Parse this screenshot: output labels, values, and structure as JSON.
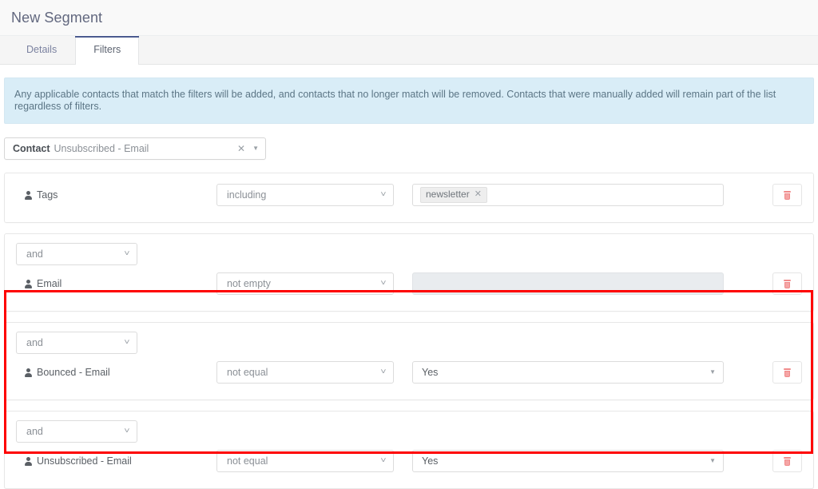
{
  "header": {
    "title": "New Segment"
  },
  "tabs": [
    {
      "label": "Details",
      "active": false
    },
    {
      "label": "Filters",
      "active": true
    }
  ],
  "alert": {
    "text": "Any applicable contacts that match the filters will be added, and contacts that no longer match will be removed. Contacts that were manually added will remain part of the list regardless of filters."
  },
  "contact_select": {
    "label": "Contact",
    "value": "Unsubscribed - Email",
    "clear_icon": "close-icon",
    "caret_icon": "caret-down-icon"
  },
  "filters": [
    {
      "glue": null,
      "field_label": "Tags",
      "field_icon": "user-icon",
      "operator": "including",
      "value_type": "tags",
      "tags": [
        {
          "label": "newsletter",
          "remove_icon": "close-icon"
        }
      ],
      "delete_icon": "trash-icon"
    },
    {
      "glue": "and",
      "field_label": "Email",
      "field_icon": "user-icon",
      "operator": "not empty",
      "value_type": "disabled-text",
      "value": "",
      "delete_icon": "trash-icon"
    },
    {
      "glue": "and",
      "field_label": "Bounced - Email",
      "field_icon": "user-icon",
      "operator": "not equal",
      "value_type": "select",
      "value": "Yes",
      "delete_icon": "trash-icon"
    },
    {
      "glue": "and",
      "field_label": "Unsubscribed - Email",
      "field_icon": "user-icon",
      "operator": "not equal",
      "value_type": "select",
      "value": "Yes",
      "delete_icon": "trash-icon"
    }
  ],
  "highlight": {
    "color": "#fe0000"
  }
}
